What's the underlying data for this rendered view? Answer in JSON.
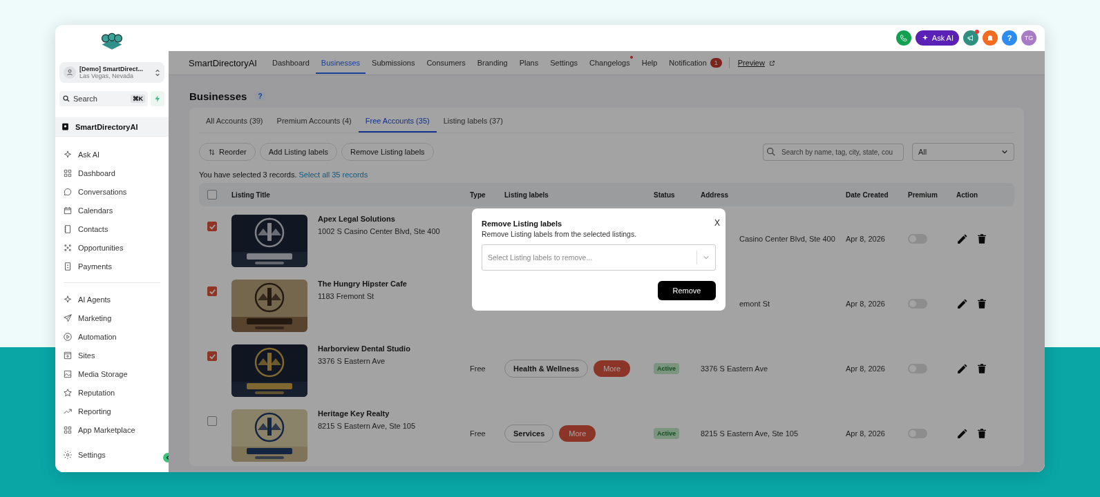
{
  "sidebar": {
    "account": {
      "name": "[Demo] SmartDirect...",
      "location": "Las Vegas, Nevada"
    },
    "search": {
      "placeholder": "Search",
      "shortcut": "⌘K"
    },
    "app": {
      "label": "SmartDirectoryAI",
      "selected": true
    },
    "groups": [
      [
        {
          "label": "Ask AI"
        },
        {
          "label": "Dashboard"
        },
        {
          "label": "Conversations"
        },
        {
          "label": "Calendars"
        },
        {
          "label": "Contacts"
        },
        {
          "label": "Opportunities"
        },
        {
          "label": "Payments"
        }
      ],
      [
        {
          "label": "AI Agents"
        },
        {
          "label": "Marketing"
        },
        {
          "label": "Automation"
        },
        {
          "label": "Sites"
        },
        {
          "label": "Media Storage"
        },
        {
          "label": "Reputation"
        },
        {
          "label": "Reporting"
        },
        {
          "label": "App Marketplace"
        }
      ]
    ],
    "settings": "Settings"
  },
  "topbar": {
    "ask_ai": "Ask AI",
    "help": "?",
    "avatar": "TG",
    "notify_dot": true
  },
  "nav": {
    "brand": "SmartDirectoryAI",
    "items": [
      {
        "label": "Dashboard",
        "selected": false,
        "dot": false
      },
      {
        "label": "Businesses",
        "selected": true,
        "dot": false
      },
      {
        "label": "Submissions",
        "selected": false,
        "dot": false
      },
      {
        "label": "Consumers",
        "selected": false,
        "dot": false
      },
      {
        "label": "Branding",
        "selected": false,
        "dot": false
      },
      {
        "label": "Plans",
        "selected": false,
        "dot": false
      },
      {
        "label": "Settings",
        "selected": false,
        "dot": false
      },
      {
        "label": "Changelogs",
        "selected": false,
        "dot": true
      },
      {
        "label": "Help",
        "selected": false,
        "dot": false
      },
      {
        "label": "Notification",
        "selected": false,
        "dot": false,
        "badge": "1"
      }
    ],
    "preview": "Preview"
  },
  "page": {
    "title": "Businesses",
    "help": "?"
  },
  "tabs": [
    {
      "label": "All Accounts (39)",
      "selected": false
    },
    {
      "label": "Premium Accounts (4)",
      "selected": false
    },
    {
      "label": "Free Accounts (35)",
      "selected": true
    },
    {
      "label": "Listing labels (37)",
      "selected": false
    }
  ],
  "toolbar": {
    "buttons": [
      "Reorder",
      "Add Listing labels",
      "Remove Listing labels"
    ],
    "search": {
      "placeholder": "Search by name, tag, city, state, cou"
    },
    "filter": "All"
  },
  "selection": {
    "text": "You have selected 3 records.",
    "link": "Select all 35 records"
  },
  "table": {
    "header_checked": false,
    "columns": [
      "Listing Title",
      "Type",
      "Listing labels",
      "Status",
      "Address",
      "Date Created",
      "Premium",
      "Action"
    ],
    "rows": [
      {
        "checked": true,
        "title": "Apex Legal Solutions",
        "subtitle": "1002 S Casino Center Blvd, Ste 400",
        "address": "Casino Center Blvd, Ste 400",
        "date": "Apr 8, 2026",
        "premium": false
      },
      {
        "checked": true,
        "title": "The Hungry Hipster Cafe",
        "subtitle": "1183 Fremont St",
        "address": "emont St",
        "date": "Apr 8, 2026",
        "premium": false
      },
      {
        "checked": true,
        "title": "Harborview Dental Studio",
        "subtitle": "3376 S Eastern Ave",
        "type": "Free",
        "labels": [
          "Health & Wellness"
        ],
        "more": "More",
        "status": "Active",
        "address": "3376 S Eastern Ave",
        "date": "Apr 8, 2026",
        "premium": false
      },
      {
        "checked": false,
        "title": "Heritage Key Realty",
        "subtitle": "8215 S Eastern Ave, Ste 105",
        "type": "Free",
        "labels": [
          "Services"
        ],
        "more": "More",
        "status": "Active",
        "address": "8215 S Eastern Ave, Ste 105",
        "date": "Apr 8, 2026",
        "premium": false
      }
    ]
  },
  "modal": {
    "title": "Remove Listing labels",
    "subtitle": "Remove Listing labels from the selected listings.",
    "close": "X",
    "select": {
      "placeholder": "Select Listing labels to remove..."
    },
    "button": "Remove"
  }
}
